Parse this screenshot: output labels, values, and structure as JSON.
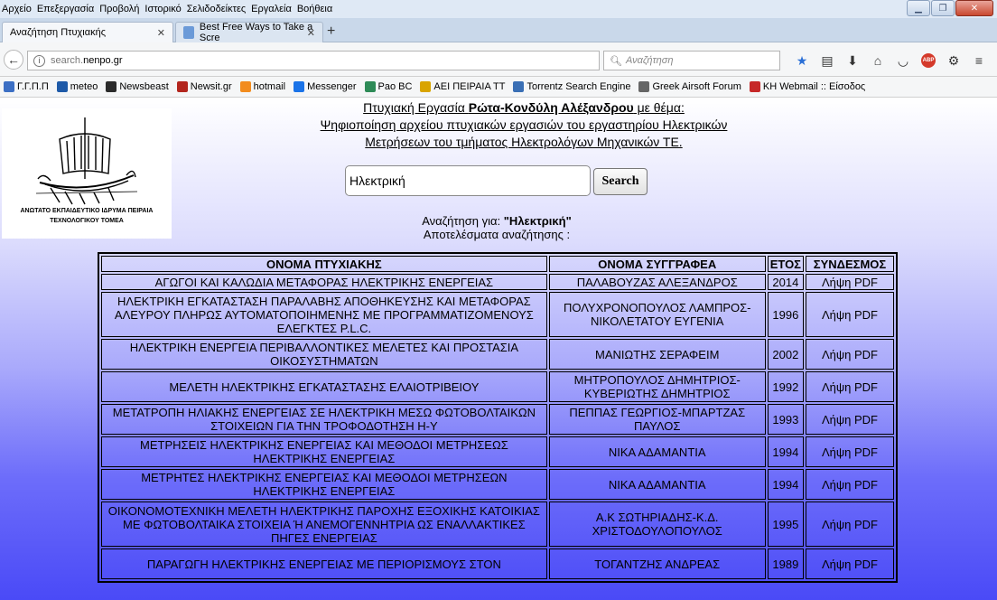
{
  "menubar": {
    "items": [
      "Αρχείο",
      "Επεξεργασία",
      "Προβολή",
      "Ιστορικό",
      "Σελιδοδείκτες",
      "Εργαλεία",
      "Βοήθεια"
    ]
  },
  "tabs": [
    {
      "label": "Αναζήτηση Πτυχιακής"
    },
    {
      "label": "Best Free Ways to Take a Scre"
    }
  ],
  "address": {
    "url_prefix": "search.",
    "url_host": "nenpo.gr",
    "search_placeholder": "Αναζήτηση"
  },
  "bookmarks": [
    {
      "label": "Γ.Γ.Π.Π",
      "color": "#3c6fc4"
    },
    {
      "label": "meteo",
      "color": "#1e5aa8"
    },
    {
      "label": "Newsbeast",
      "color": "#2b2b2b"
    },
    {
      "label": "Newsit.gr",
      "color": "#b3261e"
    },
    {
      "label": "hotmail",
      "color": "#f28c1e"
    },
    {
      "label": "Messenger",
      "color": "#1a73e8"
    },
    {
      "label": "Pao BC",
      "color": "#2e8b57"
    },
    {
      "label": "ΑΕΙ ΠΕΙΡΑΙΑ ΤΤ",
      "color": "#d9a400"
    },
    {
      "label": "Torrentz Search Engine",
      "color": "#3a6fb5"
    },
    {
      "label": "Greek Airsoft Forum",
      "color": "#666666"
    },
    {
      "label": "KH Webmail :: Είσοδος",
      "color": "#c62828"
    }
  ],
  "logo": {
    "line1": "ΑΝΩΤΑΤΟ ΕΚΠΑΙΔΕΥΤΙΚΟ ΙΔΡΥΜΑ ΠΕΙΡΑΙΑ",
    "line2": "ΤΕΧΝΟΛΟΓΙΚΟΥ ΤΟΜΕΑ"
  },
  "header": {
    "line1_a": "Πτυχιακή Εργασία ",
    "line1_name": "Ρώτα-Κονδύλη Αλέξανδρου",
    "line1_b": " με θέμα:",
    "line2": "Ψηφιοποίηση αρχείου πτυχιακών εργασιών του εργαστηρίου Ηλεκτρικών",
    "line3": "Μετρήσεων του τμήματος Ηλεκτρολόγων Μηχανικών ΤΕ."
  },
  "search": {
    "value": "Ηλεκτρική",
    "button": "Search"
  },
  "results_info": {
    "query_label": "Αναζήτηση για: ",
    "query_value": "\"Ηλεκτρική\"",
    "results_label": "Αποτελέσματα αναζήτησης :"
  },
  "table": {
    "headers": [
      "ΟΝΟΜΑ ΠΤΥΧΙΑΚΗΣ",
      "ΟΝΟΜΑ ΣΥΓΓΡΑΦΕΑ",
      "ΕΤΟΣ",
      "ΣΥΝΔΕΣΜΟΣ"
    ],
    "rows": [
      {
        "title": "ΑΓΩΓΟΙ ΚΑΙ ΚΑΛΩΔΙΑ ΜΕΤΑΦΟΡΑΣ ΗΛΕΚΤΡΙΚΗΣ ΕΝΕΡΓΕΙΑΣ",
        "author": "ΠΑΛΑΒΟΥΖΑΣ ΑΛΕΞΑΝΔΡΟΣ",
        "year": "2014",
        "link": "Λήψη PDF"
      },
      {
        "title": "ΗΛΕΚΤΡΙΚΗ ΕΓΚΑΤΑΣΤΑΣΗ ΠΑΡΑΛΑΒΗΣ ΑΠΟΘΗΚΕΥΣΗΣ ΚΑΙ ΜΕΤΑΦΟΡΑΣ ΑΛΕΥΡΟΥ ΠΛΗΡΩΣ ΑΥΤΟΜΑΤΟΠΟΙΗΜΕΝΗΣ ΜΕ ΠΡΟΓΡΑΜΜΑΤΙΖΟΜΕΝΟΥΣ ΕΛΕΓΚΤΕΣ P.L.C.",
        "author": "ΠΟΛΥΧΡΟΝΟΠΟΥΛΟΣ ΛΑΜΠΡΟΣ-ΝΙΚΟΛΕΤΑΤΟΥ ΕΥΓΕΝΙΑ",
        "year": "1996",
        "link": "Λήψη PDF"
      },
      {
        "title": "ΗΛΕΚΤΡΙΚΗ ΕΝΕΡΓΕΙΑ ΠΕΡΙΒΑΛΛΟΝΤΙΚΕΣ ΜΕΛΕΤΕΣ ΚΑΙ ΠΡΟΣΤΑΣΙΑ ΟΙΚΟΣΥΣΤΗΜΑΤΩΝ",
        "author": "ΜΑΝΙΩΤΗΣ ΣΕΡΑΦΕΙΜ",
        "year": "2002",
        "link": "Λήψη PDF"
      },
      {
        "title": "ΜΕΛΕΤΗ ΗΛΕΚΤΡΙΚΗΣ ΕΓΚΑΤΑΣΤΑΣΗΣ ΕΛΑΙΟΤΡΙΒΕΙΟΥ",
        "author": "ΜΗΤΡΟΠΟΥΛΟΣ ΔΗΜΗΤΡΙΟΣ-ΚΥΒΕΡΙΩΤΗΣ ΔΗΜΗΤΡΙΟΣ",
        "year": "1992",
        "link": "Λήψη PDF"
      },
      {
        "title": "ΜΕΤΑΤΡΟΠΗ ΗΛΙΑΚΗΣ ΕΝΕΡΓΕΙΑΣ ΣΕ ΗΛΕΚΤΡΙΚΗ ΜΕΣΩ ΦΩΤΟΒΟΛΤΑΙΚΩΝ ΣΤΟΙΧΕΙΩΝ ΓΙΑ ΤΗΝ ΤΡΟΦΟΔΟΤΗΣΗ Η-Υ",
        "author": "ΠΕΠΠΑΣ ΓΕΩΡΓΙΟΣ-ΜΠΑΡΤΖΑΣ ΠΑΥΛΟΣ",
        "year": "1993",
        "link": "Λήψη PDF"
      },
      {
        "title": "ΜΕΤΡΗΣΕΙΣ ΗΛΕΚΤΡΙΚΗΣ ΕΝΕΡΓΕΙΑΣ ΚΑΙ ΜΕΘΟΔΟΙ ΜΕΤΡΗΣΕΩΣ ΗΛΕΚΤΡΙΚΗΣ ΕΝΕΡΓΕΙΑΣ",
        "author": "ΝΙΚΑ ΑΔΑΜΑΝΤΙΑ",
        "year": "1994",
        "link": "Λήψη PDF"
      },
      {
        "title": "ΜΕΤΡΗΤΕΣ ΗΛΕΚΤΡΙΚΗΣ ΕΝΕΡΓΕΙΑΣ ΚΑΙ ΜΕΘΟΔΟΙ ΜΕΤΡΗΣΕΩΝ ΗΛΕΚΤΡΙΚΗΣ ΕΝΕΡΓΕΙΑΣ",
        "author": "ΝΙΚΑ ΑΔΑΜΑΝΤΙΑ",
        "year": "1994",
        "link": "Λήψη PDF"
      },
      {
        "title": "ΟΙΚΟΝΟΜΟΤΕΧΝΙΚΗ ΜΕΛΕΤΗ ΗΛΕΚΤΡΙΚΗΣ ΠΑΡΟΧΗΣ ΕΞΟΧΙΚΗΣ ΚΑΤΟΙΚΙΑΣ ΜΕ ΦΩΤΟΒΟΛΤΑΙΚΑ ΣΤΟΙΧΕΙΑ Ή ΑΝΕΜΟΓΕΝΝΗΤΡΙΑ ΩΣ ΕΝΑΛΛΑΚΤΙΚΕΣ ΠΗΓΕΣ ΕΝΕΡΓΕΙΑΣ",
        "author": "Α.Κ ΣΩΤΗΡΙΑΔΗΣ-Κ.Δ. ΧΡΙΣΤΟΔΟΥΛΟΠΟΥΛΟΣ",
        "year": "1995",
        "link": "Λήψη PDF"
      },
      {
        "title": "ΠΑΡΑΓΩΓΗ ΗΛΕΚΤΡΙΚΗΣ ΕΝΕΡΓΕΙΑΣ ΜΕ ΠΕΡΙΟΡΙΣΜΟΥΣ ΣΤΟΝ",
        "author": "ΤΟΓΑΝΤΖΗΣ ΑΝΔΡΕΑΣ",
        "year": "1989",
        "link": "Λήψη PDF"
      }
    ]
  }
}
